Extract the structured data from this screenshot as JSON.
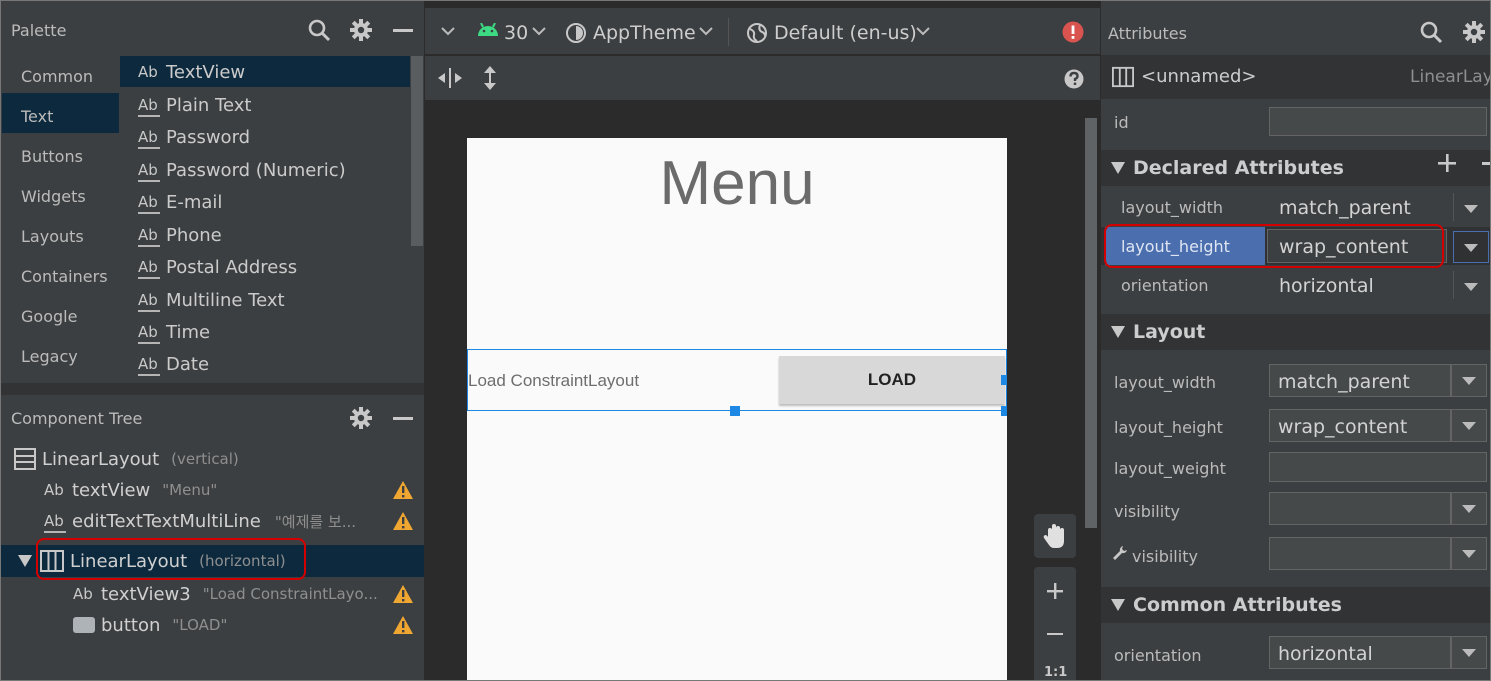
{
  "palette": {
    "title": "Palette",
    "categories": [
      "Common",
      "Text",
      "Buttons",
      "Widgets",
      "Layouts",
      "Containers",
      "Google",
      "Legacy"
    ],
    "selected_category": "Text",
    "items": [
      "TextView",
      "Plain Text",
      "Password",
      "Password (Numeric)",
      "E-mail",
      "Phone",
      "Postal Address",
      "Multiline Text",
      "Time",
      "Date"
    ],
    "ab": "Ab"
  },
  "tree": {
    "title": "Component Tree",
    "nodes": [
      {
        "label": "LinearLayout",
        "sub": "(vertical)"
      },
      {
        "label": "textView",
        "sub": "\"Menu\""
      },
      {
        "label": "editTextTextMultiLine",
        "sub": "\"예제를 보..."
      },
      {
        "label": "LinearLayout",
        "sub": "(horizontal)"
      },
      {
        "label": "textView3",
        "sub": "\"Load ConstraintLayo..."
      },
      {
        "label": "button",
        "sub": "\"LOAD\""
      }
    ]
  },
  "toolbar": {
    "api": "30",
    "theme": "AppTheme",
    "locale": "Default (en-us)"
  },
  "design": {
    "menu_text": "Menu",
    "row_text": "Load ConstraintLayout",
    "button_text": "LOAD",
    "zoom_label": "1:1"
  },
  "attributes": {
    "title": "Attributes",
    "component_name": "<unnamed>",
    "component_type": "LinearLay",
    "id_label": "id",
    "declared": {
      "title": "Declared Attributes",
      "rows": [
        {
          "label": "layout_width",
          "value": "match_parent"
        },
        {
          "label": "layout_height",
          "value": "wrap_content"
        },
        {
          "label": "orientation",
          "value": "horizontal"
        }
      ]
    },
    "layout": {
      "title": "Layout",
      "rows": [
        {
          "label": "layout_width",
          "value": "match_parent"
        },
        {
          "label": "layout_height",
          "value": "wrap_content"
        },
        {
          "label": "layout_weight",
          "value": ""
        },
        {
          "label": "visibility",
          "value": ""
        },
        {
          "label": "visibility",
          "value": ""
        }
      ]
    },
    "common": {
      "title": "Common Attributes",
      "rows": [
        {
          "label": "orientation",
          "value": "horizontal"
        }
      ]
    }
  },
  "colors": {
    "selection": "#0d293e",
    "highlight_row": "#4b6eaf",
    "warning": "#f0a732",
    "error": "#d9534f",
    "android_green": "#3ddc84",
    "annotation_red": "#d40000",
    "blueprint_blue": "#1e88e5"
  }
}
